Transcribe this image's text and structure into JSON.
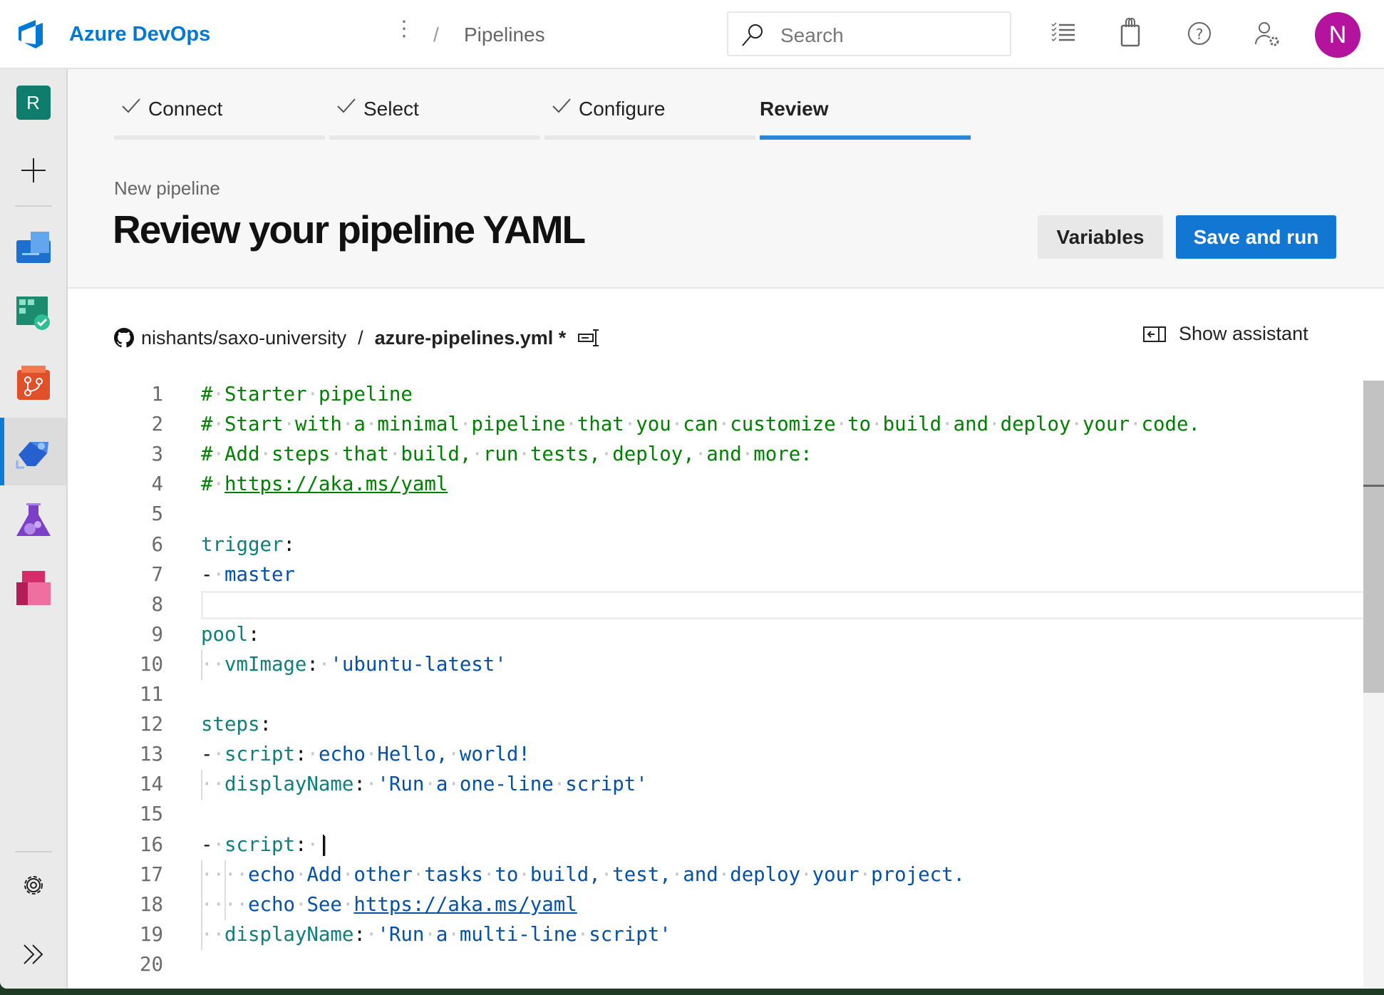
{
  "header": {
    "brand": "Azure DevOps",
    "breadcrumb": "Pipelines",
    "search_placeholder": "Search",
    "avatar_initial": "N",
    "avatar_color": "#b4139d",
    "accent": "#0078d4"
  },
  "sidebar": {
    "project_initial": "R",
    "items": [
      "new",
      "boards",
      "repos-check",
      "repos",
      "pipelines",
      "test-plans",
      "artifacts"
    ],
    "active": "pipelines"
  },
  "wizard": {
    "steps": [
      {
        "label": "Connect",
        "done": true
      },
      {
        "label": "Select",
        "done": true
      },
      {
        "label": "Configure",
        "done": true
      },
      {
        "label": "Review",
        "done": false,
        "current": true
      }
    ]
  },
  "page": {
    "subtitle": "New pipeline",
    "title": "Review your pipeline YAML",
    "variables_label": "Variables",
    "save_label": "Save and run"
  },
  "file": {
    "repo": "nishants/saxo-university",
    "separator": "/",
    "name": "azure-pipelines.yml *",
    "assistant_label": "Show assistant"
  },
  "editor": {
    "lines": [
      [
        [
          "comment",
          "#"
        ],
        [
          "ws",
          "·"
        ],
        [
          "comment",
          "Starter"
        ],
        [
          "ws",
          "·"
        ],
        [
          "comment",
          "pipeline"
        ]
      ],
      [
        [
          "comment",
          "#"
        ],
        [
          "ws",
          "·"
        ],
        [
          "comment",
          "Start"
        ],
        [
          "ws",
          "·"
        ],
        [
          "comment",
          "with"
        ],
        [
          "ws",
          "·"
        ],
        [
          "comment",
          "a"
        ],
        [
          "ws",
          "·"
        ],
        [
          "comment",
          "minimal"
        ],
        [
          "ws",
          "·"
        ],
        [
          "comment",
          "pipeline"
        ],
        [
          "ws",
          "·"
        ],
        [
          "comment",
          "that"
        ],
        [
          "ws",
          "·"
        ],
        [
          "comment",
          "you"
        ],
        [
          "ws",
          "·"
        ],
        [
          "comment",
          "can"
        ],
        [
          "ws",
          "·"
        ],
        [
          "comment",
          "customize"
        ],
        [
          "ws",
          "·"
        ],
        [
          "comment",
          "to"
        ],
        [
          "ws",
          "·"
        ],
        [
          "comment",
          "build"
        ],
        [
          "ws",
          "·"
        ],
        [
          "comment",
          "and"
        ],
        [
          "ws",
          "·"
        ],
        [
          "comment",
          "deploy"
        ],
        [
          "ws",
          "·"
        ],
        [
          "comment",
          "your"
        ],
        [
          "ws",
          "·"
        ],
        [
          "comment",
          "code."
        ]
      ],
      [
        [
          "comment",
          "#"
        ],
        [
          "ws",
          "·"
        ],
        [
          "comment",
          "Add"
        ],
        [
          "ws",
          "·"
        ],
        [
          "comment",
          "steps"
        ],
        [
          "ws",
          "·"
        ],
        [
          "comment",
          "that"
        ],
        [
          "ws",
          "·"
        ],
        [
          "comment",
          "build,"
        ],
        [
          "ws",
          "·"
        ],
        [
          "comment",
          "run"
        ],
        [
          "ws",
          "·"
        ],
        [
          "comment",
          "tests,"
        ],
        [
          "ws",
          "·"
        ],
        [
          "comment",
          "deploy,"
        ],
        [
          "ws",
          "·"
        ],
        [
          "comment",
          "and"
        ],
        [
          "ws",
          "·"
        ],
        [
          "comment",
          "more:"
        ]
      ],
      [
        [
          "comment",
          "#"
        ],
        [
          "ws",
          "·"
        ],
        [
          "comment-link",
          "https://aka.ms/yaml"
        ]
      ],
      [],
      [
        [
          "key",
          "trigger"
        ],
        [
          "punct",
          ":"
        ]
      ],
      [
        [
          "punct",
          "-"
        ],
        [
          "ws",
          "·"
        ],
        [
          "val",
          "master"
        ]
      ],
      [],
      [
        [
          "key",
          "pool"
        ],
        [
          "punct",
          ":"
        ]
      ],
      [
        [
          "ws",
          "··"
        ],
        [
          "key",
          "vmImage"
        ],
        [
          "punct",
          ":"
        ],
        [
          "ws",
          "·"
        ],
        [
          "val",
          "'ubuntu-latest'"
        ]
      ],
      [],
      [
        [
          "key",
          "steps"
        ],
        [
          "punct",
          ":"
        ]
      ],
      [
        [
          "punct",
          "-"
        ],
        [
          "ws",
          "·"
        ],
        [
          "key",
          "script"
        ],
        [
          "punct",
          ":"
        ],
        [
          "ws",
          "·"
        ],
        [
          "val",
          "echo"
        ],
        [
          "ws",
          "·"
        ],
        [
          "val",
          "Hello,"
        ],
        [
          "ws",
          "·"
        ],
        [
          "val",
          "world!"
        ]
      ],
      [
        [
          "ws",
          "··"
        ],
        [
          "key",
          "displayName"
        ],
        [
          "punct",
          ":"
        ],
        [
          "ws",
          "·"
        ],
        [
          "val",
          "'Run"
        ],
        [
          "ws",
          "·"
        ],
        [
          "val",
          "a"
        ],
        [
          "ws",
          "·"
        ],
        [
          "val",
          "one-line"
        ],
        [
          "ws",
          "·"
        ],
        [
          "val",
          "script'"
        ]
      ],
      [],
      [
        [
          "punct",
          "-"
        ],
        [
          "ws",
          "·"
        ],
        [
          "key",
          "script"
        ],
        [
          "punct",
          ":"
        ],
        [
          "ws",
          "·"
        ],
        [
          "punct",
          "|"
        ]
      ],
      [
        [
          "ws",
          "····"
        ],
        [
          "val",
          "echo"
        ],
        [
          "ws",
          "·"
        ],
        [
          "val",
          "Add"
        ],
        [
          "ws",
          "·"
        ],
        [
          "val",
          "other"
        ],
        [
          "ws",
          "·"
        ],
        [
          "val",
          "tasks"
        ],
        [
          "ws",
          "·"
        ],
        [
          "val",
          "to"
        ],
        [
          "ws",
          "·"
        ],
        [
          "val",
          "build,"
        ],
        [
          "ws",
          "·"
        ],
        [
          "val",
          "test,"
        ],
        [
          "ws",
          "·"
        ],
        [
          "val",
          "and"
        ],
        [
          "ws",
          "·"
        ],
        [
          "val",
          "deploy"
        ],
        [
          "ws",
          "·"
        ],
        [
          "val",
          "your"
        ],
        [
          "ws",
          "·"
        ],
        [
          "val",
          "project."
        ]
      ],
      [
        [
          "ws",
          "····"
        ],
        [
          "val",
          "echo"
        ],
        [
          "ws",
          "·"
        ],
        [
          "val",
          "See"
        ],
        [
          "ws",
          "·"
        ],
        [
          "val-link",
          "https://aka.ms/yaml"
        ]
      ],
      [
        [
          "ws",
          "··"
        ],
        [
          "key",
          "displayName"
        ],
        [
          "punct",
          ":"
        ],
        [
          "ws",
          "·"
        ],
        [
          "val",
          "'Run"
        ],
        [
          "ws",
          "·"
        ],
        [
          "val",
          "a"
        ],
        [
          "ws",
          "·"
        ],
        [
          "val",
          "multi-line"
        ],
        [
          "ws",
          "·"
        ],
        [
          "val",
          "script'"
        ]
      ],
      []
    ],
    "current_line": 8,
    "cursor_line": 16
  }
}
